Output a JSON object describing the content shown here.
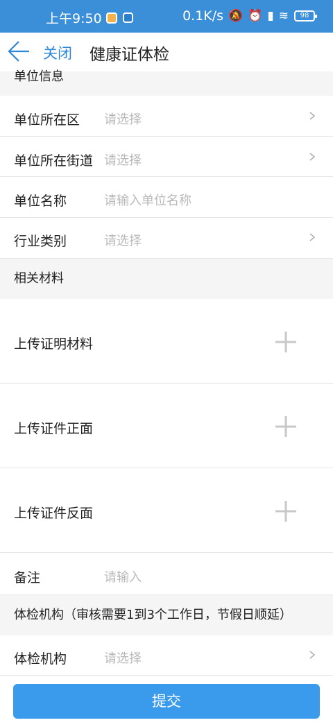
{
  "status_bar": {
    "time": "上午9:50",
    "network_speed": "0.1K/s",
    "battery": "98"
  },
  "nav": {
    "close_label": "关闭",
    "title": "健康证体检"
  },
  "unit_section": {
    "header": "单位信息",
    "rows": [
      {
        "label": "单位所在区",
        "value": "请选择",
        "chevron": true
      },
      {
        "label": "单位所在街道",
        "value": "请选择",
        "chevron": true
      },
      {
        "label": "单位名称",
        "value": "请输入单位名称",
        "chevron": false
      },
      {
        "label": "行业类别",
        "value": "请选择",
        "chevron": true
      }
    ]
  },
  "materials_section": {
    "header": "相关材料",
    "uploads": [
      {
        "label": "上传证明材料"
      },
      {
        "label": "上传证件正面"
      },
      {
        "label": "上传证件反面"
      }
    ]
  },
  "remark": {
    "label": "备注",
    "placeholder": "请输入"
  },
  "institution_section": {
    "header": "体检机构（审核需要1到3个工作日，节假日顺延）",
    "row": {
      "label": "体检机构",
      "value": "请选择"
    }
  },
  "submit_label": "提交",
  "colors": {
    "status_bar": "#3a8fd8",
    "accent": "#2e87d8",
    "button": "#3a9bec",
    "placeholder": "#b8b8b8",
    "section_bg": "#f5f5f5"
  }
}
